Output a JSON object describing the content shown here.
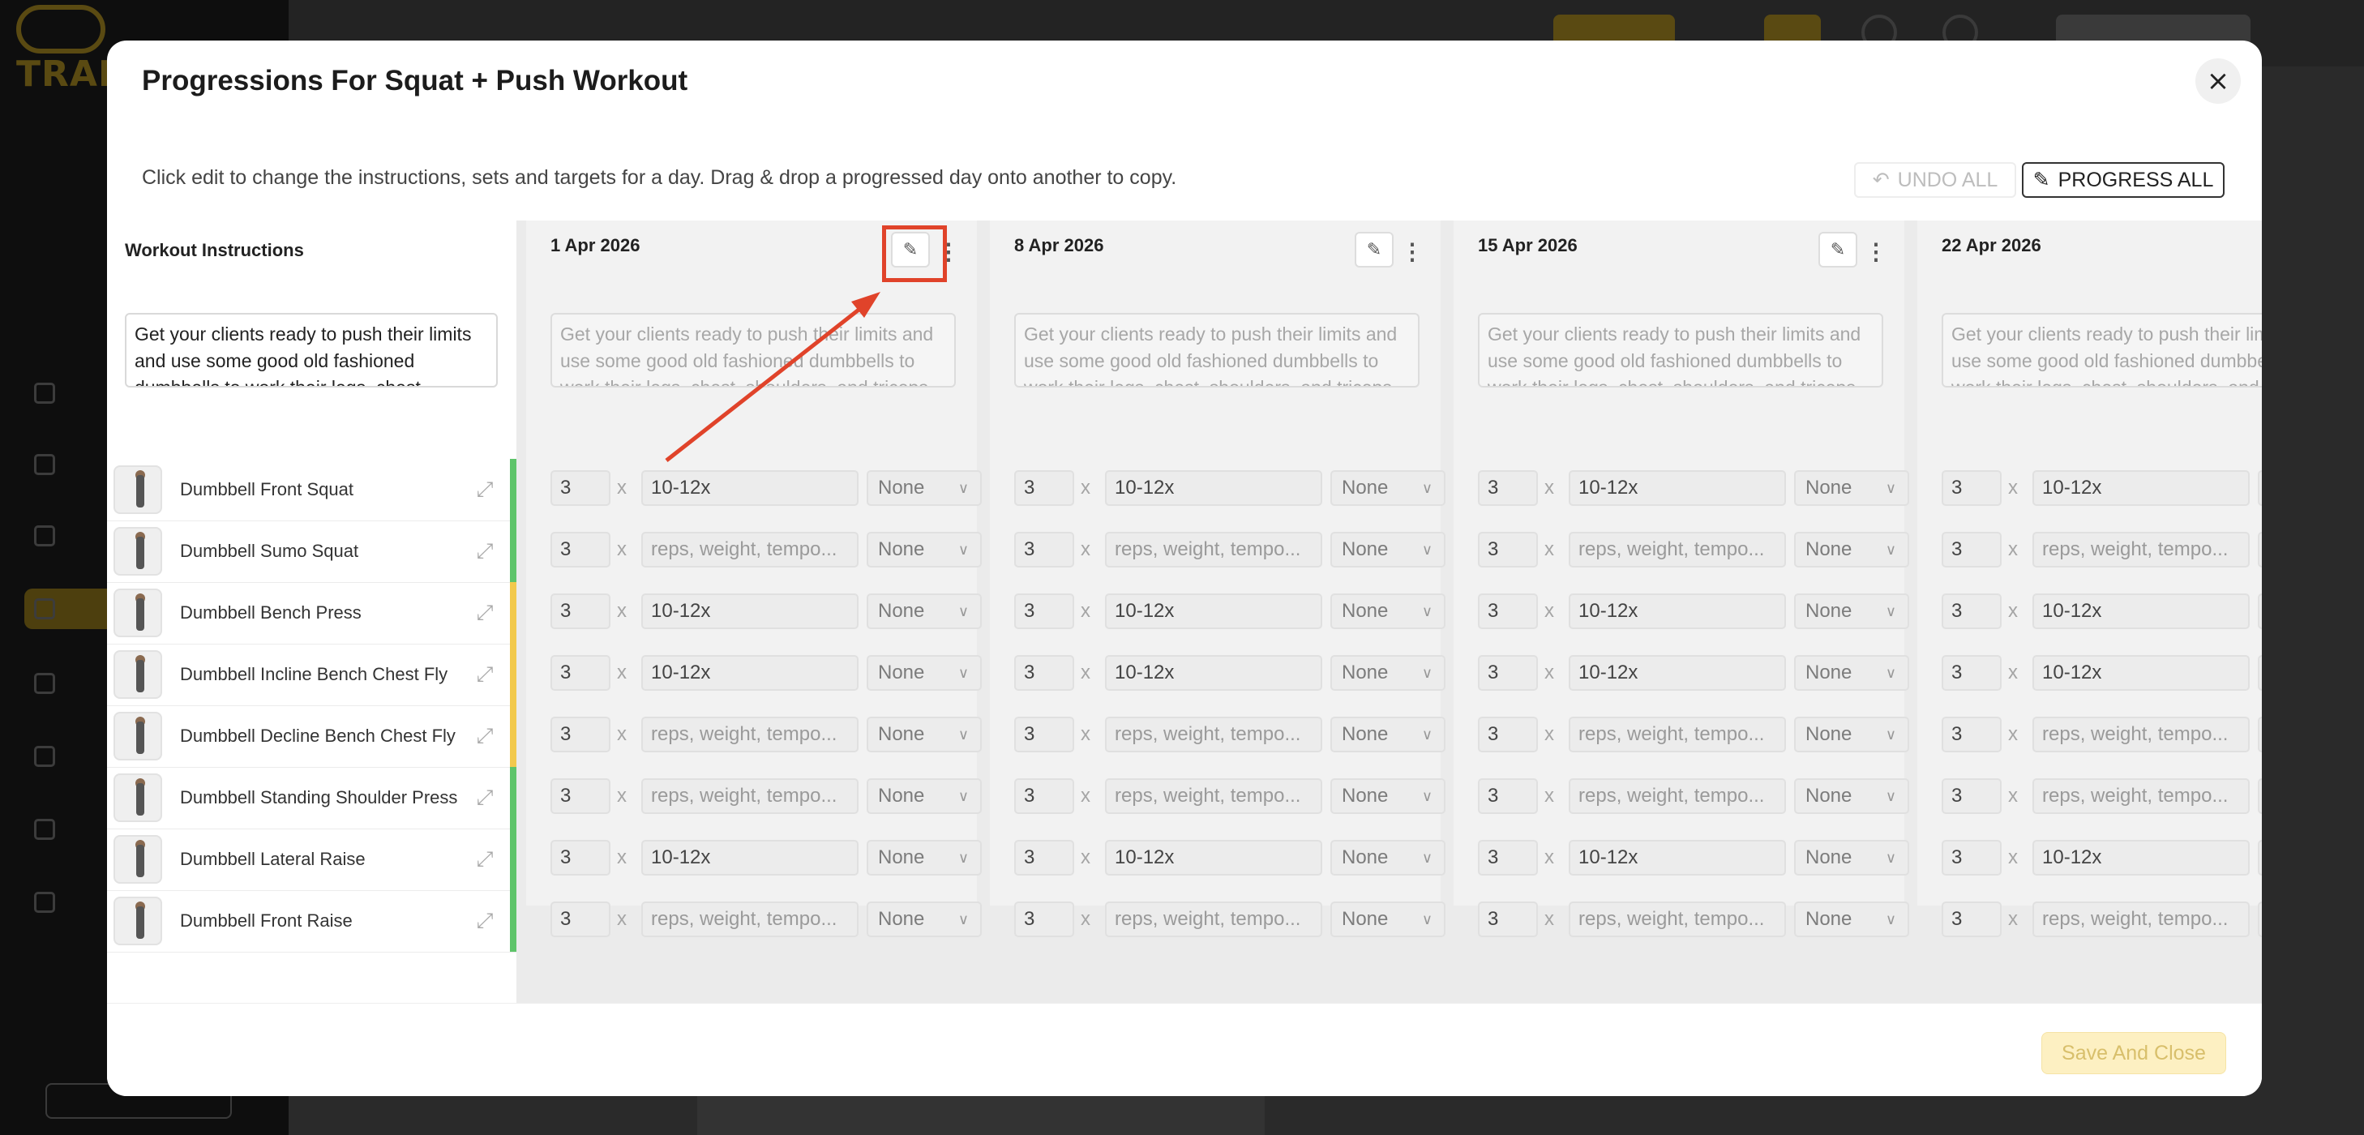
{
  "background": {
    "logo_text": "TRAINERIZE"
  },
  "modal": {
    "title": "Progressions For Squat + Push Workout",
    "description": "Click edit to change the instructions, sets and targets for a day. Drag & drop a progressed day onto another to copy.",
    "undo_all_label": "UNDO ALL",
    "progress_all_label": "PROGRESS ALL",
    "save_label": "Save And Close",
    "close_icon": "×"
  },
  "left": {
    "header": "Workout Instructions",
    "instructions": "Get your clients ready to push their limits and use some good old fashioned dumbbells to work their legs, chest, shoulders, and triceps."
  },
  "exercises": [
    {
      "name": "Dumbbell Front Squat",
      "bar": "#5ec46a"
    },
    {
      "name": "Dumbbell Sumo Squat",
      "bar": "#5ec46a"
    },
    {
      "name": "Dumbbell Bench Press",
      "bar": "#f2c94c"
    },
    {
      "name": "Dumbbell Incline Bench Chest Fly",
      "bar": "#f2c94c"
    },
    {
      "name": "Dumbbell Decline Bench Chest Fly",
      "bar": "#f2c94c"
    },
    {
      "name": "Dumbbell Standing Shoulder Press",
      "bar": "#5ec46a"
    },
    {
      "name": "Dumbbell Lateral Raise",
      "bar": "#5ec46a"
    },
    {
      "name": "Dumbbell Front Raise",
      "bar": "#5ec46a"
    }
  ],
  "days": [
    {
      "date": "1 Apr 2026"
    },
    {
      "date": "8 Apr 2026"
    },
    {
      "date": "15 Apr 2026"
    },
    {
      "date": "22 Apr 2026"
    }
  ],
  "day_instructions_placeholder": "Get your clients ready to push their limits and use some good old fashioned dumbbells to work their legs, chest, shoulders, and triceps.",
  "rows": [
    {
      "sets": "3",
      "target": "10-12x",
      "target_is_value": true,
      "type": "None"
    },
    {
      "sets": "3",
      "target": "reps, weight, tempo...",
      "target_is_value": false,
      "type": "None"
    },
    {
      "sets": "3",
      "target": "10-12x",
      "target_is_value": true,
      "type": "None"
    },
    {
      "sets": "3",
      "target": "10-12x",
      "target_is_value": true,
      "type": "None"
    },
    {
      "sets": "3",
      "target": "reps, weight, tempo...",
      "target_is_value": false,
      "type": "None"
    },
    {
      "sets": "3",
      "target": "reps, weight, tempo...",
      "target_is_value": false,
      "type": "None"
    },
    {
      "sets": "3",
      "target": "10-12x",
      "target_is_value": true,
      "type": "None"
    },
    {
      "sets": "3",
      "target": "reps, weight, tempo...",
      "target_is_value": false,
      "type": "None"
    }
  ],
  "times_symbol": "x",
  "icons": {
    "edit": "pencil-icon",
    "more": "kebab-icon",
    "undo": "undo-icon",
    "drag": "drag-handle-icon",
    "select": "chevron-down-icon",
    "close": "close-icon"
  },
  "colors": {
    "annotation": "#e0432a",
    "save_bg": "#fdf0c2"
  }
}
